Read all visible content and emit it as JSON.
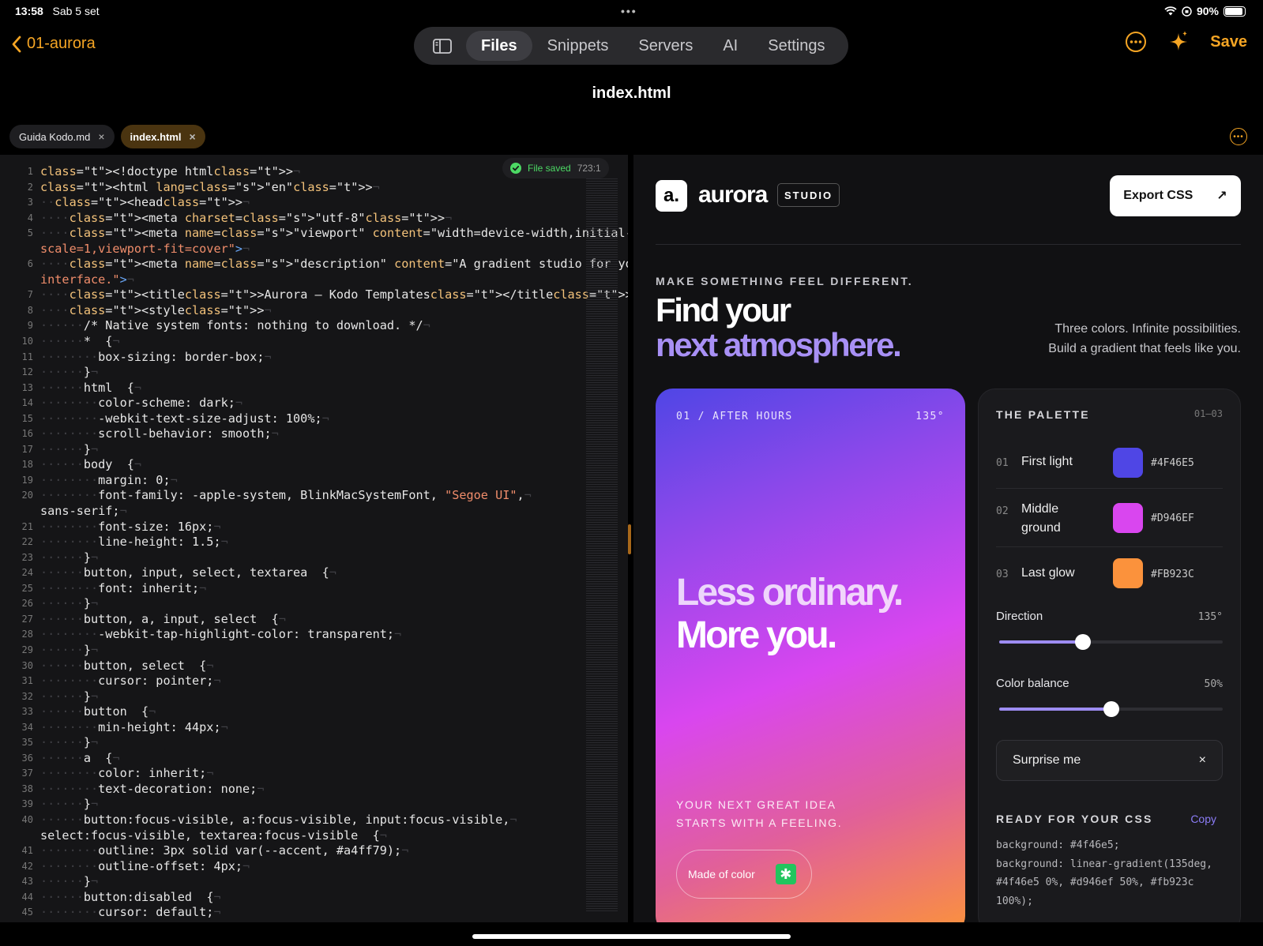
{
  "status": {
    "time": "13:58",
    "date": "Sab 5 set",
    "battery": "90%",
    "battery_fraction": 0.9,
    "dots": "•••"
  },
  "nav": {
    "back_label": "01-aurora",
    "tabs": [
      "Files",
      "Snippets",
      "Servers",
      "AI",
      "Settings"
    ],
    "active_tab": "Files",
    "save_label": "Save"
  },
  "file_title": "index.html",
  "open_tabs": [
    {
      "label": "Guida Kodo.md",
      "close": "×"
    },
    {
      "label": "index.html",
      "close": "×"
    }
  ],
  "editor": {
    "saved_label": "File saved",
    "cursor_pos": "723:1",
    "line_numbers": [
      "1",
      "2",
      "3",
      "4",
      "5",
      "",
      "6",
      "",
      "7",
      "8",
      "9",
      "10",
      "11",
      "12",
      "13",
      "14",
      "15",
      "16",
      "17",
      "18",
      "19",
      "20",
      "",
      "21",
      "22",
      "23",
      "24",
      "25",
      "26",
      "27",
      "28",
      "29",
      "30",
      "31",
      "32",
      "33",
      "34",
      "35",
      "36",
      "37",
      "38",
      "39",
      "40",
      "",
      "41",
      "42",
      "43",
      "44",
      "45"
    ],
    "lines": [
      "<!doctype html>",
      "<html lang=\"en\">",
      "  <head>",
      "    <meta charset=\"utf-8\">",
      "    <meta name=\"viewport\" content=\"width=device-width,initial-",
      "scale=1,viewport-fit=cover\">",
      "    <meta name=\"description\" content=\"A gradient studio for your nex",
      "interface.\">",
      "    <title>Aurora — Kodo Templates</title>",
      "    <style>",
      "      /* Native system fonts: nothing to download. */",
      "      *  {",
      "        box-sizing: border-box;",
      "      }",
      "      html  {",
      "        color-scheme: dark;",
      "        -webkit-text-size-adjust: 100%;",
      "        scroll-behavior: smooth;",
      "      }",
      "      body  {",
      "        margin: 0;",
      "        font-family: -apple-system, BlinkMacSystemFont, \"Segoe UI\",",
      "sans-serif;",
      "        font-size: 16px;",
      "        line-height: 1.5;",
      "      }",
      "      button, input, select, textarea  {",
      "        font: inherit;",
      "      }",
      "      button, a, input, select  {",
      "        -webkit-tap-highlight-color: transparent;",
      "      }",
      "      button, select  {",
      "        cursor: pointer;",
      "      }",
      "      button  {",
      "        min-height: 44px;",
      "      }",
      "      a  {",
      "        color: inherit;",
      "        text-decoration: none;",
      "      }",
      "      button:focus-visible, a:focus-visible, input:focus-visible,",
      "select:focus-visible, textarea:focus-visible  {",
      "        outline: 3px solid var(--accent, #a4ff79);",
      "        outline-offset: 4px;",
      "      }",
      "      button:disabled  {",
      "        cursor: default;"
    ]
  },
  "preview": {
    "logo_mark": "a.",
    "logo_text": "aurora",
    "studio_label": "STUDIO",
    "export_label": "Export CSS",
    "export_arrow": "↗",
    "eyebrow": "MAKE SOMETHING FEEL DIFFERENT.",
    "headline_1": "Find your",
    "headline_2": "next atmosphere.",
    "subcopy_1": "Three colors. Infinite possibilities.",
    "subcopy_2": "Build a gradient that feels like you.",
    "card": {
      "label": "01 / AFTER HOURS",
      "angle": "135°",
      "big_1": "Less ordinary.",
      "big_2": "More you.",
      "small_1": "YOUR NEXT GREAT IDEA",
      "small_2": "STARTS WITH A FEELING.",
      "chip_label": "Made of color",
      "chip_icon": "✱"
    },
    "palette": {
      "title": "THE PALETTE",
      "range": "01—03",
      "colors": [
        {
          "num": "01",
          "name": "First light",
          "hex": "#4F46E5",
          "color": "#4f46e5"
        },
        {
          "num": "02",
          "name": "Middle ground",
          "hex": "#D946EF",
          "color": "#d946ef"
        },
        {
          "num": "03",
          "name": "Last glow",
          "hex": "#FB923C",
          "color": "#fb923c"
        }
      ],
      "direction_label": "Direction",
      "direction_value": "135°",
      "direction_fraction": 0.375,
      "balance_label": "Color balance",
      "balance_value": "50%",
      "balance_fraction": 0.5,
      "surprise_label": "Surprise me",
      "surprise_icon": "×",
      "ready_label": "READY FOR YOUR CSS",
      "copy_label": "Copy",
      "css": "background: #4f46e5;\nbackground: linear-gradient(135deg, #4f46e5 0%, #d946ef 50%, #fb923c 100%);"
    }
  },
  "colors": {
    "accent": "#f5a524",
    "bg": "#000000",
    "editor_bg": "#151517",
    "saved_green": "#4cd964"
  }
}
